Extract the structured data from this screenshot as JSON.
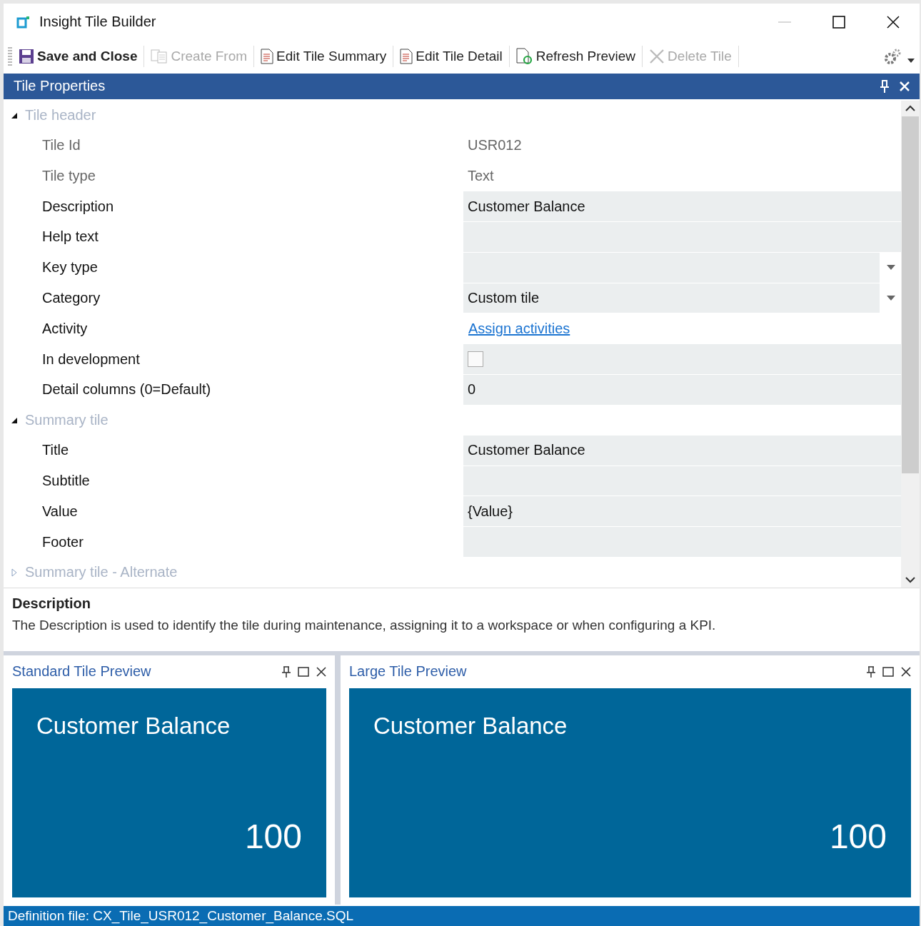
{
  "window": {
    "title": "Insight Tile Builder"
  },
  "toolbar": [
    {
      "label": "Save and Close",
      "kind": "save",
      "disabled": false
    },
    {
      "label": "Create From",
      "kind": "copy",
      "disabled": true
    },
    {
      "label": "Edit Tile Summary",
      "kind": "doc",
      "disabled": false
    },
    {
      "label": "Edit Tile Detail",
      "kind": "doc",
      "disabled": false
    },
    {
      "label": "Refresh Preview",
      "kind": "refresh",
      "disabled": false
    },
    {
      "label": "Delete Tile",
      "kind": "delete",
      "disabled": true
    }
  ],
  "properties_panel": {
    "title": "Tile Properties",
    "sections": [
      {
        "title": "Tile header",
        "expanded": true,
        "rows": [
          {
            "label": "Tile Id",
            "kind": "readonly",
            "value": "USR012"
          },
          {
            "label": "Tile type",
            "kind": "readonly",
            "value": "Text"
          },
          {
            "label": "Description",
            "kind": "text",
            "value": "Customer Balance"
          },
          {
            "label": "Help text",
            "kind": "text"
          },
          {
            "label": "Key type",
            "kind": "dropdown"
          },
          {
            "label": "Category",
            "kind": "dropdown",
            "value": "Custom tile"
          },
          {
            "label": "Activity",
            "kind": "link",
            "value": "Assign activities"
          },
          {
            "label": "In development",
            "kind": "checkbox",
            "checked": false
          },
          {
            "label": "Detail columns (0=Default)",
            "kind": "text",
            "value": "0"
          }
        ]
      },
      {
        "title": "Summary tile",
        "expanded": true,
        "rows": [
          {
            "label": "Title",
            "kind": "text",
            "value": "Customer Balance"
          },
          {
            "label": "Subtitle",
            "kind": "text"
          },
          {
            "label": "Value",
            "kind": "text",
            "value": "{Value}"
          },
          {
            "label": "Footer",
            "kind": "text"
          }
        ]
      },
      {
        "title": "Summary tile - Alternate",
        "expanded": false
      }
    ]
  },
  "description": {
    "title": "Description",
    "text": "The Description is used to identify the tile during maintenance, assigning it to a workspace or when configuring a KPI."
  },
  "previews": [
    {
      "title": "Standard Tile Preview",
      "tile_title": "Customer Balance",
      "tile_value": "100"
    },
    {
      "title": "Large Tile Preview",
      "tile_title": "Customer Balance",
      "tile_value": "100"
    }
  ],
  "status_bar": {
    "text": "Definition file: CX_Tile_USR012_Customer_Balance.SQL"
  }
}
